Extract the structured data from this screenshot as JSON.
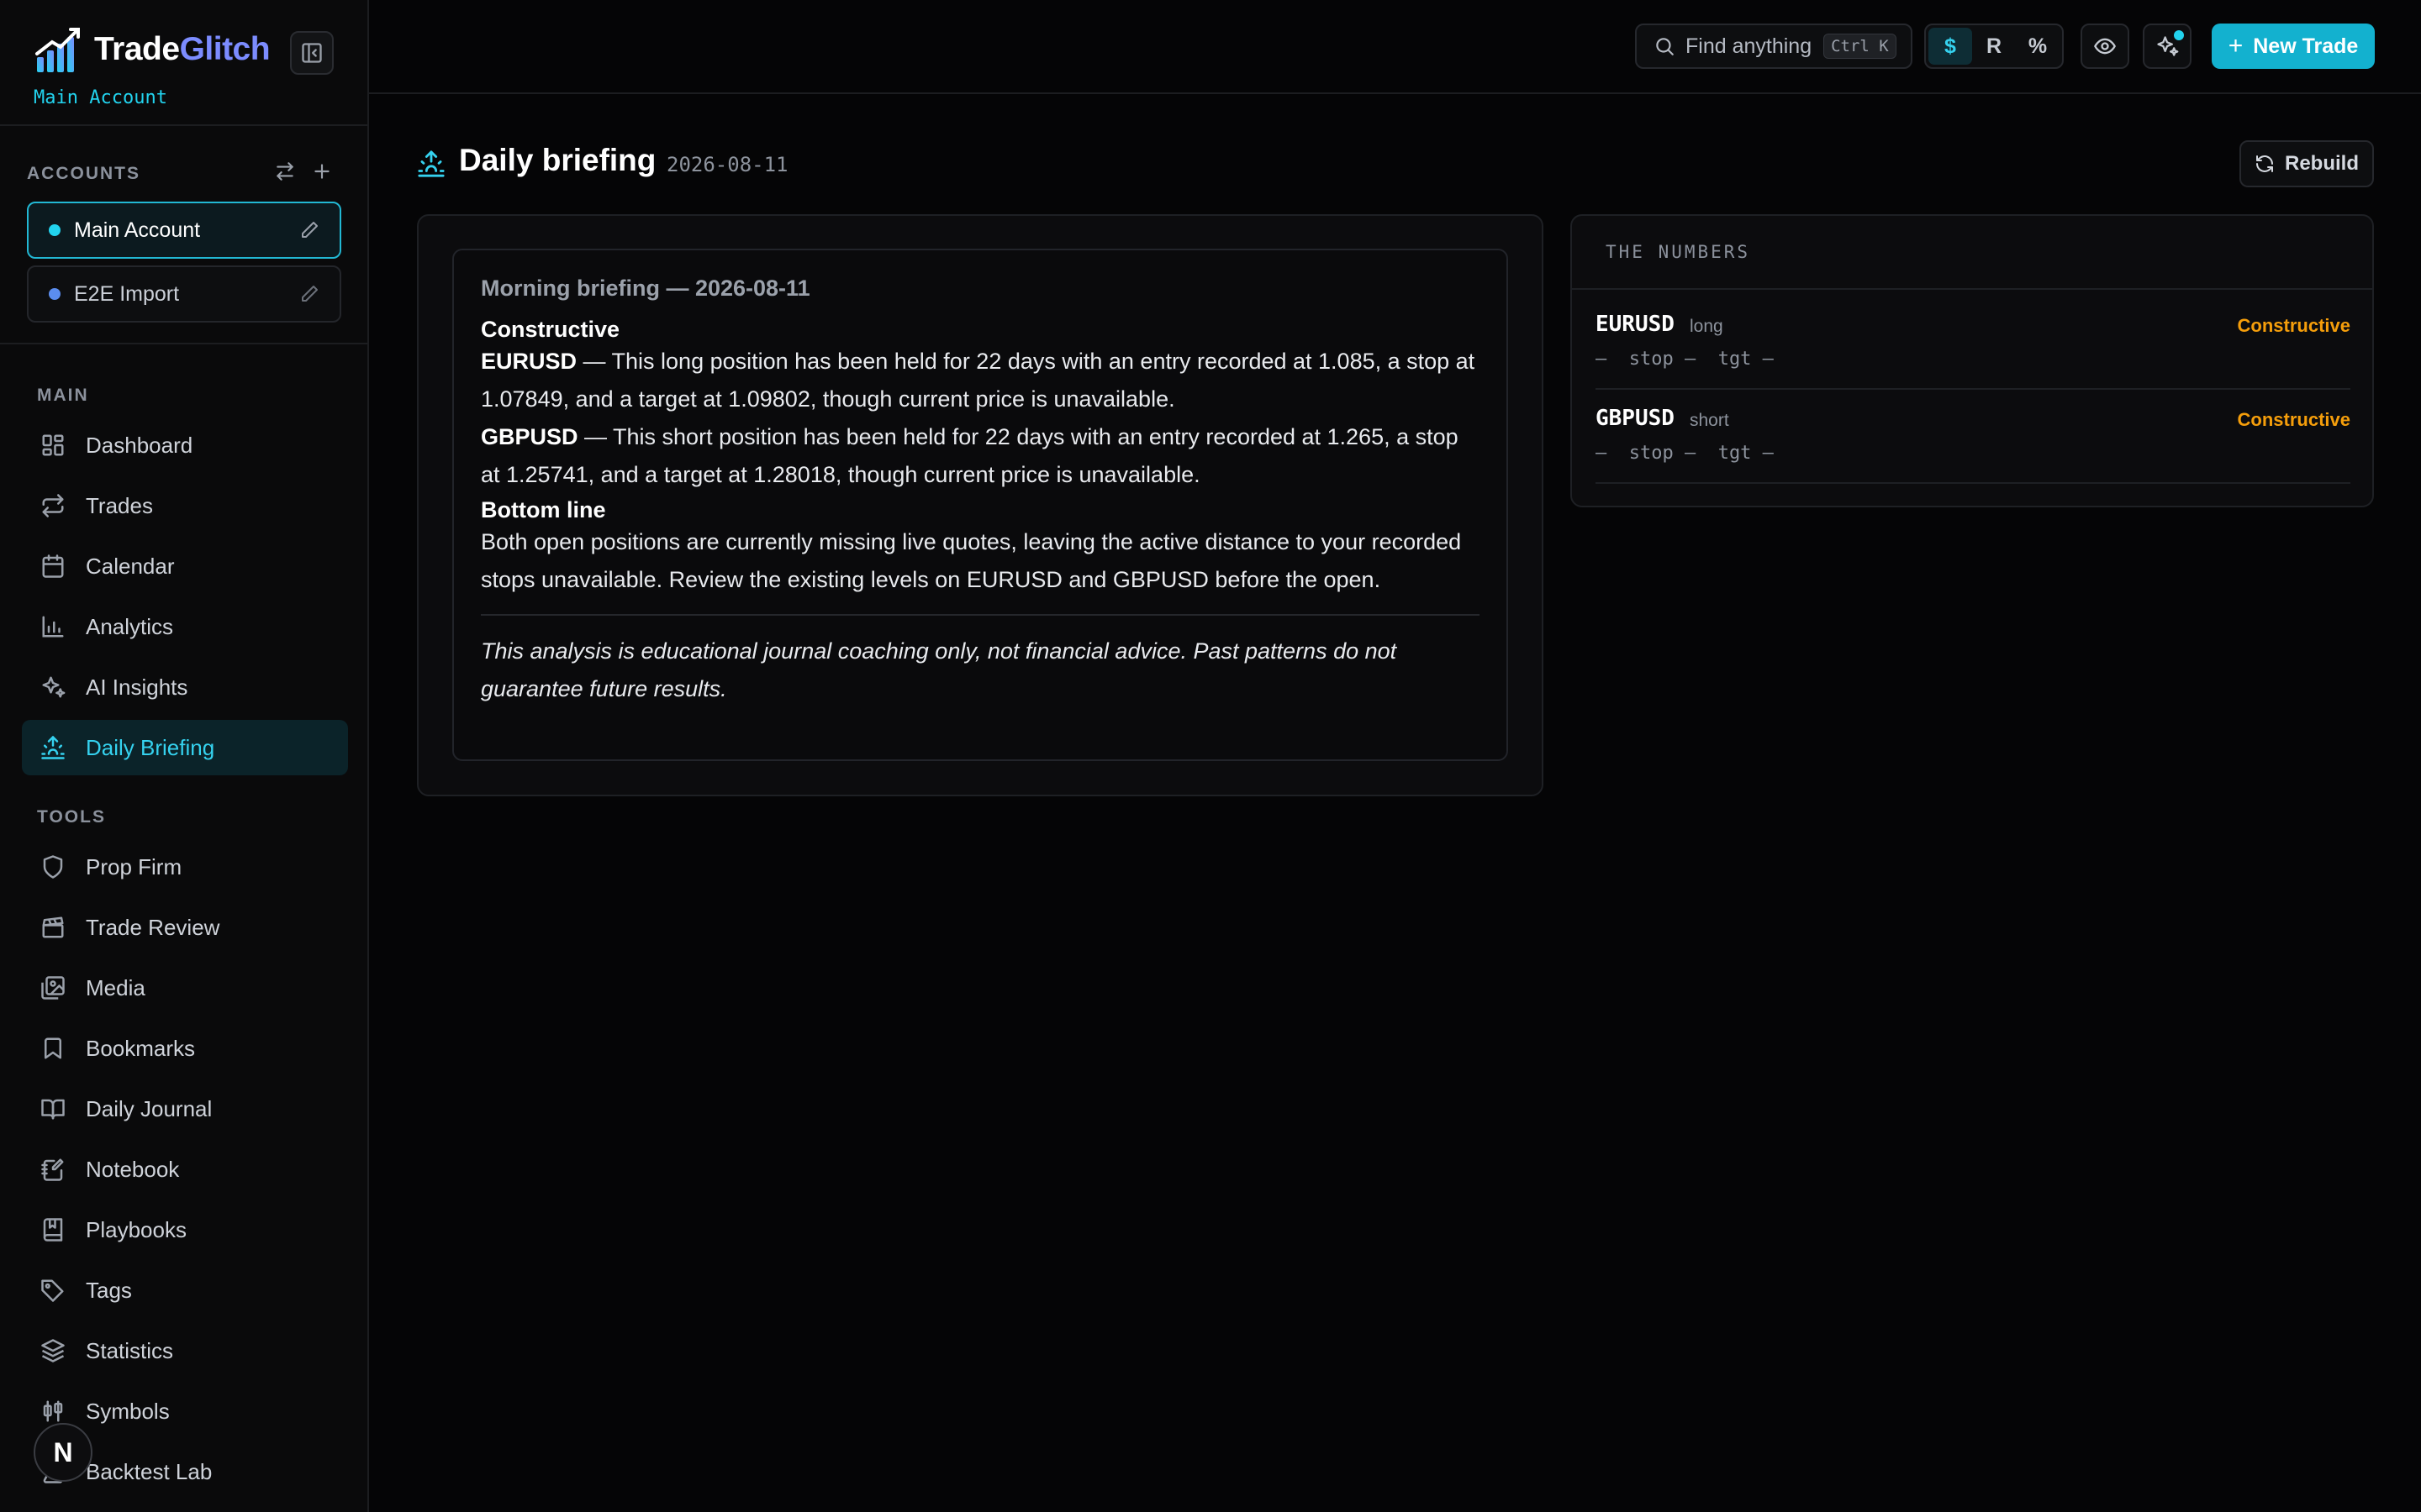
{
  "brand": {
    "name_part1": "Trade",
    "name_part2": "Glitch",
    "account_label": "Main Account"
  },
  "accounts": {
    "heading": "ACCOUNTS",
    "items": [
      {
        "name": "Main Account",
        "dot_color": "#22d3ee"
      },
      {
        "name": "E2E Import",
        "dot_color": "#5b8def"
      }
    ]
  },
  "nav": {
    "main_heading": "MAIN",
    "main_items": [
      {
        "label": "Dashboard",
        "icon": "dashboard-icon"
      },
      {
        "label": "Trades",
        "icon": "trades-icon"
      },
      {
        "label": "Calendar",
        "icon": "calendar-icon"
      },
      {
        "label": "Analytics",
        "icon": "analytics-icon"
      },
      {
        "label": "AI Insights",
        "icon": "sparkles-icon"
      },
      {
        "label": "Daily Briefing",
        "icon": "sunrise-icon"
      }
    ],
    "tools_heading": "TOOLS",
    "tools_items": [
      {
        "label": "Prop Firm",
        "icon": "shield-icon"
      },
      {
        "label": "Trade Review",
        "icon": "clapperboard-icon"
      },
      {
        "label": "Media",
        "icon": "images-icon"
      },
      {
        "label": "Bookmarks",
        "icon": "bookmark-icon"
      },
      {
        "label": "Daily Journal",
        "icon": "book-open-icon"
      },
      {
        "label": "Notebook",
        "icon": "notebook-icon"
      },
      {
        "label": "Playbooks",
        "icon": "book-icon"
      },
      {
        "label": "Tags",
        "icon": "tag-icon"
      },
      {
        "label": "Statistics",
        "icon": "layers-icon"
      },
      {
        "label": "Symbols",
        "icon": "candlestick-icon"
      },
      {
        "label": "Backtest Lab",
        "icon": "flask-icon"
      }
    ],
    "active_label": "Daily Briefing"
  },
  "fab": {
    "letter": "N"
  },
  "topbar": {
    "search_placeholder": "Find anything",
    "search_shortcut": "Ctrl K",
    "units": [
      "$",
      "R",
      "%"
    ],
    "active_unit": "$",
    "new_trade_label": "New Trade"
  },
  "page": {
    "title": "Daily briefing",
    "date": "2026-08-11",
    "rebuild_label": "Rebuild"
  },
  "briefing": {
    "title": "Morning briefing — 2026-08-11",
    "section1_heading": "Constructive",
    "eurusd_symbol": "EURUSD",
    "eurusd_text": " — This long position has been held for 22 days with an entry recorded at 1.085, a stop at 1.07849, and a target at 1.09802, though current price is unavailable.",
    "gbpusd_symbol": "GBPUSD",
    "gbpusd_text": " — This short position has been held for 22 days with an entry recorded at 1.265, a stop at 1.25741, and a target at 1.28018, though current price is unavailable.",
    "section2_heading": "Bottom line",
    "bottom_line": "Both open positions are currently missing live quotes, leaving the active distance to your recorded stops unavailable. Review the existing levels on EURUSD and GBPUSD before the open.",
    "disclaimer": "This analysis is educational journal coaching only, not financial advice. Past patterns do not guarantee future results."
  },
  "numbers": {
    "heading": "THE NUMBERS",
    "rows": [
      {
        "symbol": "EURUSD",
        "direction": "long",
        "verdict": "Constructive",
        "levels": "—  stop —  tgt —"
      },
      {
        "symbol": "GBPUSD",
        "direction": "short",
        "verdict": "Constructive",
        "levels": "—  stop —  tgt —"
      }
    ],
    "verdict_color": "#f59e0b"
  },
  "colors": {
    "accent": "#22d3ee",
    "brand_secondary": "#7c8cff",
    "primary_button": "#13b1cf"
  }
}
